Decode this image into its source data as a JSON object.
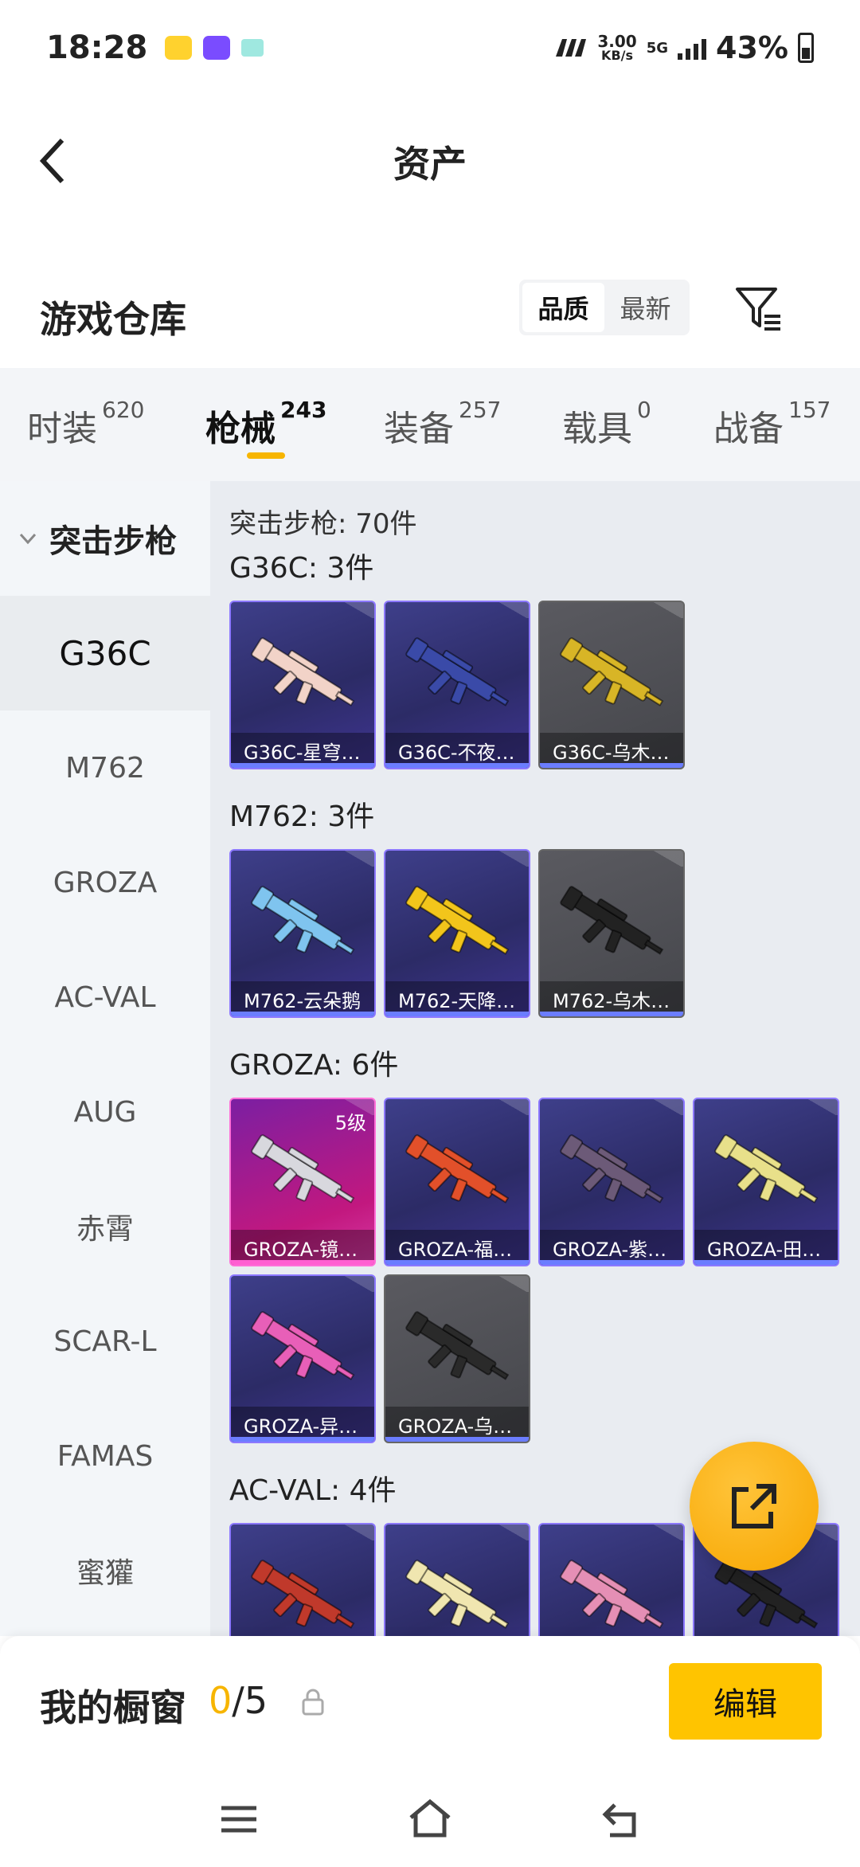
{
  "status_bar": {
    "time": "18:28",
    "speed_value": "3.00",
    "speed_unit": "KB/s",
    "network": "5G",
    "battery": "43%"
  },
  "header": {
    "title": "资产"
  },
  "warehouse": {
    "title": "游戏仓库",
    "sort_options": [
      "品质",
      "最新"
    ],
    "active_sort": "品质"
  },
  "tabs": [
    {
      "label": "时装",
      "count": "620"
    },
    {
      "label": "枪械",
      "count": "243"
    },
    {
      "label": "装备",
      "count": "257"
    },
    {
      "label": "载具",
      "count": "0"
    },
    {
      "label": "战备",
      "count": "157"
    }
  ],
  "sidebar": {
    "group": "突击步枪",
    "items": [
      "G36C",
      "M762",
      "GROZA",
      "AC-VAL",
      "AUG",
      "赤霄",
      "SCAR-L",
      "FAMAS",
      "蜜獾"
    ]
  },
  "content": {
    "total": "突击步枪: 70件",
    "sections": [
      {
        "title": "G36C: 3件",
        "items": [
          {
            "label": "G36C-星穹…",
            "style": "purple",
            "gun_color": "#f2d3c8"
          },
          {
            "label": "G36C-不夜…",
            "style": "purple",
            "gun_color": "#3a4aa8"
          },
          {
            "label": "G36C-乌木…",
            "style": "gray",
            "gun_color": "#d8b526"
          }
        ]
      },
      {
        "title": "M762: 3件",
        "items": [
          {
            "label": "M762-云朵鹅",
            "style": "purple",
            "gun_color": "#7fc4ef"
          },
          {
            "label": "M762-天降…",
            "style": "purple",
            "gun_color": "#f2c51b"
          },
          {
            "label": "M762-乌木…",
            "style": "gray",
            "gun_color": "#222222"
          }
        ]
      },
      {
        "title": "GROZA: 6件",
        "items": [
          {
            "label": "GROZA-镜…",
            "style": "pink",
            "gun_color": "#d8d8de",
            "level": "5级"
          },
          {
            "label": "GROZA-福…",
            "style": "purple",
            "gun_color": "#e2502a"
          },
          {
            "label": "GROZA-紫…",
            "style": "purple",
            "gun_color": "#6c5a78"
          },
          {
            "label": "GROZA-田…",
            "style": "purple",
            "gun_color": "#e8e08a"
          },
          {
            "label": "GROZA-异…",
            "style": "purple",
            "gun_color": "#e85fb8"
          },
          {
            "label": "GROZA-乌…",
            "style": "gray",
            "gun_color": "#2a2a2a"
          }
        ]
      },
      {
        "title": "AC-VAL: 4件",
        "items": [
          {
            "label": "",
            "style": "purple",
            "gun_color": "#c0392b"
          },
          {
            "label": "",
            "style": "purple",
            "gun_color": "#f0e6b0"
          },
          {
            "label": "",
            "style": "purple",
            "gun_color": "#e58fb5"
          },
          {
            "label": "",
            "style": "purple",
            "gun_color": "#222222"
          }
        ]
      }
    ]
  },
  "showcase": {
    "title": "我的橱窗",
    "current": "0",
    "total": "/5",
    "edit_label": "编辑"
  },
  "colors": {
    "accent": "#f7b500",
    "card_purple": "#3e3f8a",
    "card_gray": "#55565b",
    "card_pink": "#c2187f"
  }
}
